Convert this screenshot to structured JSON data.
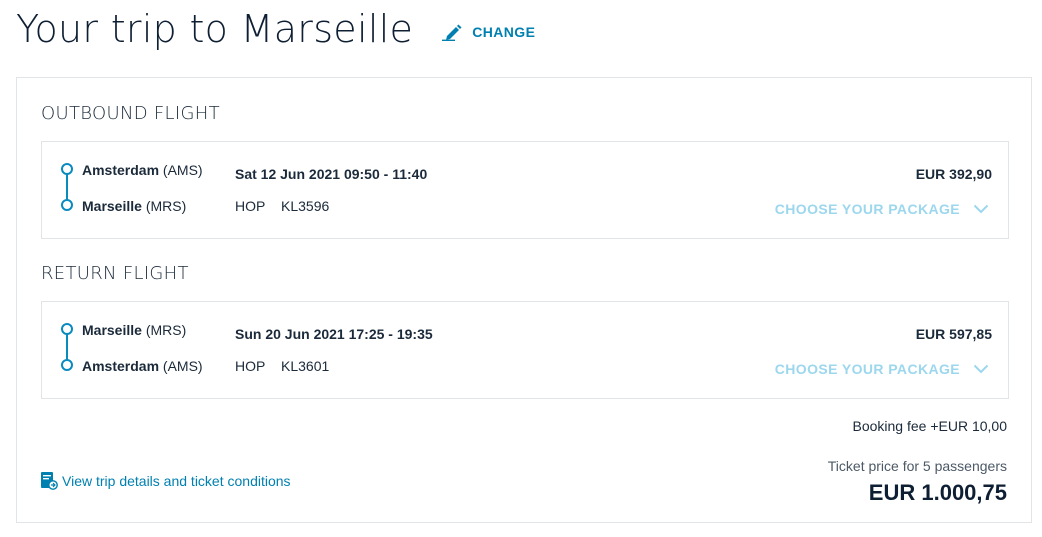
{
  "header": {
    "title": "Your trip to Marseille",
    "change_label": "CHANGE"
  },
  "outbound": {
    "section_title": "OUTBOUND FLIGHT",
    "from_city": "Amsterdam",
    "from_code": "(AMS)",
    "to_city": "Marseille",
    "to_code": "(MRS)",
    "date_time": "Sat 12 Jun 2021  09:50 - 11:40",
    "carrier": "HOP",
    "flight_number": "KL3596",
    "price": "EUR 392,90",
    "package_label": "CHOOSE YOUR PACKAGE"
  },
  "return": {
    "section_title": "RETURN FLIGHT",
    "from_city": "Marseille",
    "from_code": "(MRS)",
    "to_city": "Amsterdam",
    "to_code": "(AMS)",
    "date_time": "Sun 20 Jun 2021  17:25 - 19:35",
    "carrier": "HOP",
    "flight_number": "KL3601",
    "price": "EUR 597,85",
    "package_label": "CHOOSE YOUR PACKAGE"
  },
  "summary": {
    "booking_fee": "Booking fee +EUR 10,00",
    "ticket_label": "Ticket price for 5 passengers",
    "ticket_total": "EUR 1.000,75",
    "details_link": "View trip details and ticket conditions"
  },
  "icons": {
    "change": "pencil-icon",
    "package": "chevron-down-icon",
    "details": "ticket-conditions-icon"
  },
  "colors": {
    "accent": "#0080b0",
    "timeline": "#0a8bbf",
    "package_link": "#9cd7ee",
    "text": "#1b2a3a",
    "border": "#e2e5e8"
  }
}
